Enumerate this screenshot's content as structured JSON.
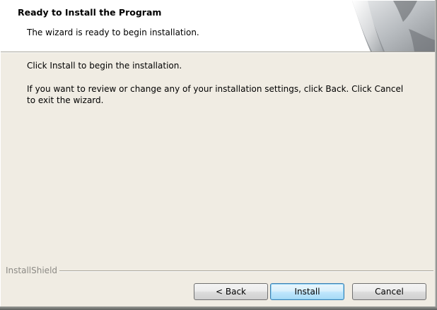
{
  "header": {
    "title": "Ready to Install the Program",
    "subtitle": "The wizard is ready to begin installation."
  },
  "body": {
    "line1": "Click Install to begin the installation.",
    "line2": "If you want to review or change any of your installation settings, click Back. Click Cancel to exit the wizard."
  },
  "footer": {
    "brand": "InstallShield"
  },
  "buttons": {
    "back": "< Back",
    "install": "Install",
    "cancel": "Cancel"
  },
  "colors": {
    "dialog_background": "#f0ece3",
    "header_background": "#ffffff",
    "default_button_border": "#3c7fb1"
  },
  "icons": {
    "header_graphic": "page-curl-banner-graphic"
  }
}
